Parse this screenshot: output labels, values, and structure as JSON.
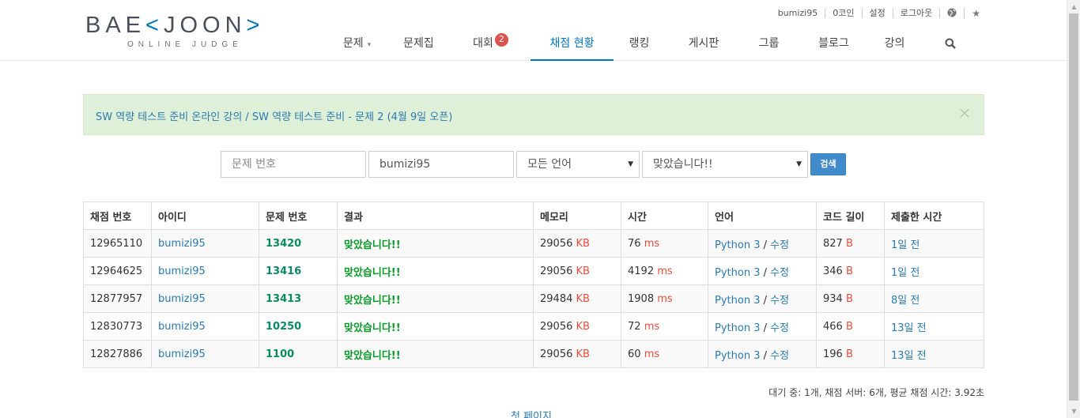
{
  "logo": {
    "main_pre": "BAE",
    "main_k": "K",
    "main_post": "JOON",
    "sub": "ONLINE JUDGE"
  },
  "top_links": [
    "bumizi95",
    "0코인",
    "설정",
    "로그아웃"
  ],
  "top_icons": [
    "globe-icon",
    "star-icon"
  ],
  "nav": [
    {
      "label": "문제",
      "has_caret": true
    },
    {
      "label": "문제집"
    },
    {
      "label": "대회",
      "badge": "2"
    },
    {
      "label": "채점 현황",
      "active": true
    },
    {
      "label": "랭킹"
    },
    {
      "label": "게시판"
    },
    {
      "label": "그룹"
    },
    {
      "label": "블로그"
    },
    {
      "label": "강의"
    }
  ],
  "alert": {
    "text": "SW 역량 테스트 준비 온라인 강의 / SW 역량 테스트 준비 - 문제 2 (4월 9일 오픈)",
    "close": "×"
  },
  "search": {
    "problem_placeholder": "문제 번호",
    "user_value": "bumizi95",
    "language_selected": "모든 언어",
    "result_selected": "맞았습니다!!",
    "button": "검색"
  },
  "table": {
    "headers": [
      "채점 번호",
      "아이디",
      "문제 번호",
      "결과",
      "메모리",
      "시간",
      "언어",
      "코드 길이",
      "제출한 시간"
    ],
    "rows": [
      {
        "id": "12965110",
        "user": "bumizi95",
        "problem": "13420",
        "result": "맞았습니다!!",
        "memory": "29056",
        "time": "76",
        "lang": "Python 3",
        "edit": "수정",
        "length": "827",
        "submitted": "1일 전"
      },
      {
        "id": "12964625",
        "user": "bumizi95",
        "problem": "13416",
        "result": "맞았습니다!!",
        "memory": "29056",
        "time": "4192",
        "lang": "Python 3",
        "edit": "수정",
        "length": "346",
        "submitted": "1일 전"
      },
      {
        "id": "12877957",
        "user": "bumizi95",
        "problem": "13413",
        "result": "맞았습니다!!",
        "memory": "29484",
        "time": "1908",
        "lang": "Python 3",
        "edit": "수정",
        "length": "934",
        "submitted": "8일 전"
      },
      {
        "id": "12830773",
        "user": "bumizi95",
        "problem": "10250",
        "result": "맞았습니다!!",
        "memory": "29056",
        "time": "72",
        "lang": "Python 3",
        "edit": "수정",
        "length": "466",
        "submitted": "13일 전"
      },
      {
        "id": "12827886",
        "user": "bumizi95",
        "problem": "1100",
        "result": "맞았습니다!!",
        "memory": "29056",
        "time": "60",
        "lang": "Python 3",
        "edit": "수정",
        "length": "196",
        "submitted": "13일 전"
      }
    ],
    "units": {
      "memory": "KB",
      "time": "ms",
      "length": "B"
    }
  },
  "footer": {
    "stats": "대기 중: 1개, 채점 서버: 6개, 평균 채점 시간: 3.92초",
    "first_page": "첫 페이지"
  }
}
